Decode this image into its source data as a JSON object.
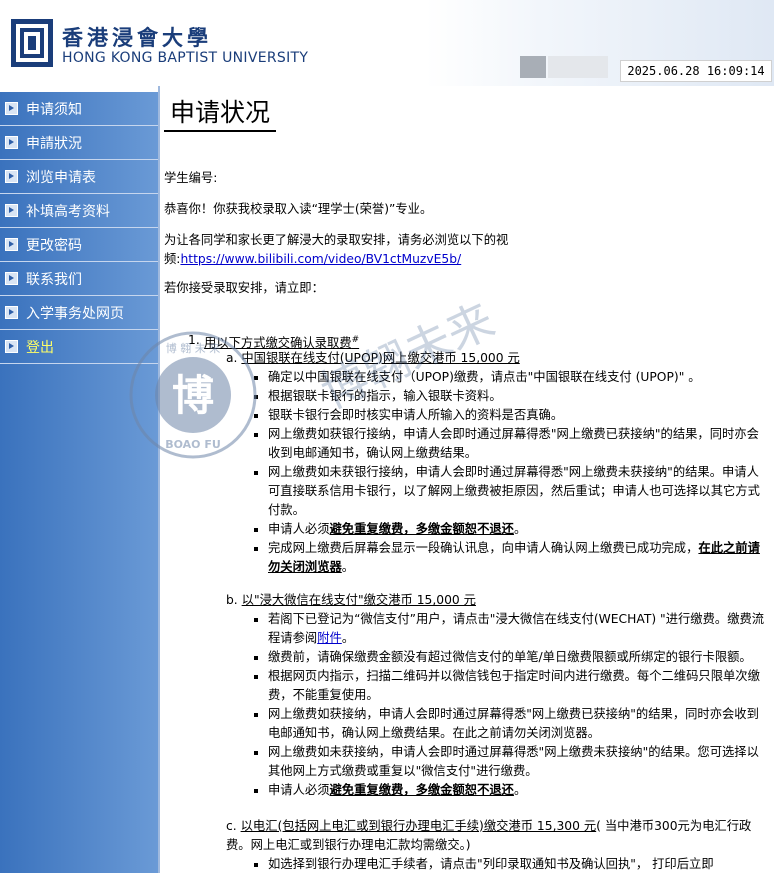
{
  "header": {
    "university_cn": "香港浸會大學",
    "university_en": "HONG KONG BAPTIST UNIVERSITY",
    "datetime": "2025.06.28 16:09:14",
    "brand_color": "#1a3d7a"
  },
  "nav": {
    "items": [
      {
        "label": "申请须知"
      },
      {
        "label": "申請狀況"
      },
      {
        "label": "浏览申请表"
      },
      {
        "label": "补填高考资料"
      },
      {
        "label": "更改密码"
      },
      {
        "label": "联系我们"
      },
      {
        "label": "入学事务处网页"
      },
      {
        "label": "登出"
      }
    ]
  },
  "main": {
    "title": "申请状况",
    "student_no_label": "学生编号:",
    "congrats": "恭喜你！你获我校录取入读“理学士(荣誉)”专业。",
    "video_text": "为让各同学和家长更了解浸大的录取安排，请务必浏览以下的视频:",
    "video_link": "https://www.bilibili.com/video/BV1ctMuzvE5b/",
    "accept_text": "若你接受录取安排，请立即：",
    "section1": {
      "num": "1.",
      "title": "用以下方式缴交确认录取费",
      "sup": "#",
      "a": {
        "label": "a.",
        "title": "中国银联在线支付(UPOP)网上缴交港币 15,000 元",
        "items": [
          "确定以中国银联在线支付（UPOP)缴费，请点击\"中国银联在线支付 (UPOP)\" 。",
          "根据银联卡银行的指示，输入银联卡资料。",
          "银联卡银行会即时核实申请人所输入的资料是否真确。",
          "网上缴费如获银行接纳，申请人会即时通过屏幕得悉\"网上缴费已获接纳\"的结果，同时亦会收到电邮通知书，确认网上缴费结果。",
          "网上缴费如未获银行接纳，申请人会即时通过屏幕得悉\"网上缴费未获接纳\"的结果。申请人可直接联系信用卡银行，以了解网上缴费被拒原因，然后重试；申请人也可选择以其它方式付款。"
        ],
        "item6_pre": "申请人必须",
        "item6_bold": "避免重复缴费，多缴金额恕不退还",
        "item6_post": "。",
        "item7_pre": "完成网上缴费后屏幕会显示一段确认讯息，向申请人确认网上缴费已成功完成，",
        "item7_bold": "在此之前请勿关闭浏览器",
        "item7_post": "。"
      },
      "b": {
        "label": "b.",
        "title": "以\"浸大微信在线支付\"缴交港币 15,000 元",
        "item1_pre": "若阁下已登记为“微信支付”用户，请点击\"浸大微信在线支付(WECHAT) \"进行缴费。缴费流程请参阅",
        "item1_link": "附件",
        "item1_post": "。",
        "items": [
          "缴费前，请确保缴费金额没有超过微信支付的单笔/单日缴费限额或所绑定的银行卡限额。",
          "根据网页内指示，扫描二维码并以微信钱包于指定时间内进行缴费。每个二维码只限单次缴费，不能重复使用。",
          "网上缴费如获接纳，申请人会即时通过屏幕得悉\"网上缴费已获接纳\"的结果，同时亦会收到电邮通知书，确认网上缴费结果。在此之前请勿关闭浏览器。",
          "网上缴费如未获接纳，申请人会即时通过屏幕得悉\"网上缴费未获接纳\"的结果。您可选择以其他网上方式缴费或重复以\"微信支付\"进行缴费。"
        ],
        "item6_pre": "申请人必须",
        "item6_bold": "避免重复缴费，多缴金额恕不退还",
        "item6_post": "。"
      },
      "c": {
        "label": "c.",
        "title": "以电汇(包括网上电汇或到银行办理电汇手续)缴交港币 15,300 元",
        "title_post": "( 当中港币300元为电汇行政费。网上电汇或到银行办理电汇款均需缴交。)",
        "item1": "如选择到银行办理电汇手续者，请点击\"列印录取通知书及确认回执\"， 打印后立即"
      }
    }
  },
  "watermark": {
    "stamp_top": "博 翱 未 来",
    "stamp_center": "博",
    "stamp_bottom": "BOAO FU",
    "text": "博翱未来"
  }
}
